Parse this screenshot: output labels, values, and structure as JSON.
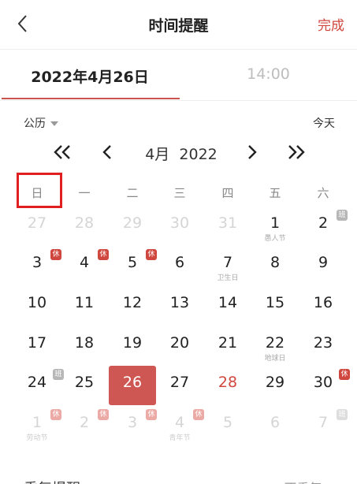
{
  "header": {
    "title": "时间提醒",
    "done_label": "完成"
  },
  "tabs": {
    "date_label": "2022年4月26日",
    "time_label": "14:00"
  },
  "calendar_type": "公历",
  "today_label": "今天",
  "nav": {
    "month": "4月",
    "year": "2022"
  },
  "weekdays": [
    "日",
    "一",
    "二",
    "三",
    "四",
    "五",
    "六"
  ],
  "selected_day": "26",
  "weeks": [
    [
      {
        "day": "27",
        "faded": true
      },
      {
        "day": "28",
        "faded": true
      },
      {
        "day": "29",
        "faded": true
      },
      {
        "day": "30",
        "faded": true
      },
      {
        "day": "31",
        "faded": true
      },
      {
        "day": "1",
        "sub": "愚人节"
      },
      {
        "day": "2",
        "badge": "班",
        "badge_type": "work"
      }
    ],
    [
      {
        "day": "3",
        "badge": "休",
        "badge_type": "rest"
      },
      {
        "day": "4",
        "badge": "休",
        "badge_type": "rest"
      },
      {
        "day": "5",
        "badge": "休",
        "badge_type": "rest"
      },
      {
        "day": "6"
      },
      {
        "day": "7",
        "sub": "卫生日"
      },
      {
        "day": "8"
      },
      {
        "day": "9"
      }
    ],
    [
      {
        "day": "10"
      },
      {
        "day": "11"
      },
      {
        "day": "12"
      },
      {
        "day": "13"
      },
      {
        "day": "14"
      },
      {
        "day": "15"
      },
      {
        "day": "16"
      }
    ],
    [
      {
        "day": "17"
      },
      {
        "day": "18"
      },
      {
        "day": "19"
      },
      {
        "day": "20"
      },
      {
        "day": "21"
      },
      {
        "day": "22",
        "sub": "地球日"
      },
      {
        "day": "23"
      }
    ],
    [
      {
        "day": "24",
        "badge": "班",
        "badge_type": "work"
      },
      {
        "day": "25"
      },
      {
        "day": "26",
        "selected": true
      },
      {
        "day": "27"
      },
      {
        "day": "28",
        "red": true
      },
      {
        "day": "29"
      },
      {
        "day": "30",
        "badge": "休",
        "badge_type": "rest"
      }
    ],
    [
      {
        "day": "1",
        "faded": true,
        "badge": "休",
        "badge_type": "rest",
        "sub": "劳动节"
      },
      {
        "day": "2",
        "faded": true,
        "badge": "休",
        "badge_type": "rest"
      },
      {
        "day": "3",
        "faded": true,
        "badge": "休",
        "badge_type": "rest"
      },
      {
        "day": "4",
        "faded": true,
        "badge": "休",
        "badge_type": "rest",
        "sub": "青年节"
      },
      {
        "day": "5",
        "faded": true
      },
      {
        "day": "6",
        "faded": true
      },
      {
        "day": "7",
        "faded": true,
        "badge": "班",
        "badge_type": "work"
      }
    ]
  ],
  "repeat": {
    "label": "重复提醒",
    "value": "不重复 >"
  },
  "colors": {
    "accent": "#d0473f",
    "selected_bg": "#cf5753",
    "highlight_box": "#e02020"
  }
}
